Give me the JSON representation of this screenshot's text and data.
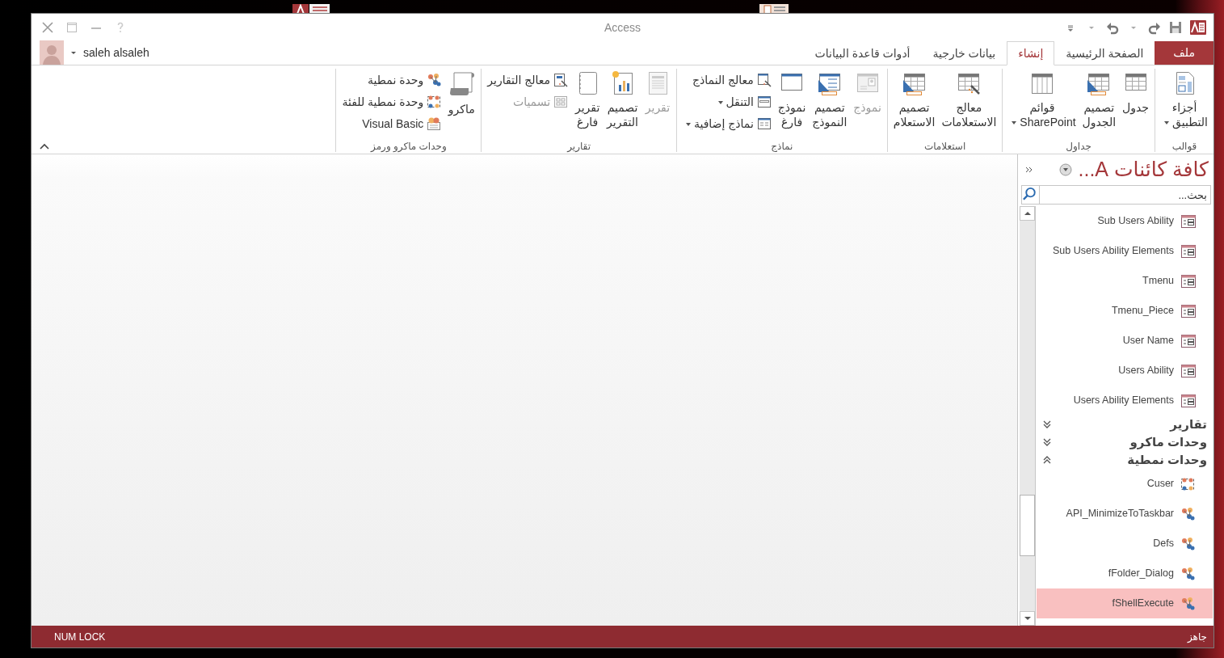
{
  "window": {
    "title": "Access"
  },
  "account": {
    "name": "saleh alsaleh"
  },
  "tabs": [
    {
      "label": "ملف",
      "kind": "file",
      "selected": false
    },
    {
      "label": "الصفحة الرئيسية",
      "kind": "tab",
      "selected": false
    },
    {
      "label": "إنشاء",
      "kind": "tab",
      "selected": true
    },
    {
      "label": "بيانات خارجية",
      "kind": "tab",
      "selected": false
    },
    {
      "label": "أدوات قاعدة البيانات",
      "kind": "tab",
      "selected": false
    }
  ],
  "ribbon_groups": [
    {
      "label": "قوالب",
      "buttons": [
        {
          "label": "أجزاء\nالتطبيق",
          "kind": "parts",
          "dropdown": true,
          "disabled": false
        }
      ]
    },
    {
      "label": "جداول",
      "buttons": [
        {
          "label": "جدول",
          "kind": "table",
          "dropdown": false,
          "disabled": false
        },
        {
          "label": "تصميم\nالجدول",
          "kind": "tabledesign",
          "dropdown": false,
          "disabled": false
        },
        {
          "label": "قوائم\nSharePoint",
          "kind": "sharepoint",
          "dropdown": true,
          "disabled": false
        }
      ]
    },
    {
      "label": "استعلامات",
      "buttons": [
        {
          "label": "معالج\nالاستعلامات",
          "kind": "querywizard",
          "dropdown": false,
          "disabled": false
        },
        {
          "label": "تصميم\nالاستعلام",
          "kind": "querydesign",
          "dropdown": false,
          "disabled": false
        }
      ]
    },
    {
      "label": "نماذج",
      "buttons": [
        {
          "label": "نموذج",
          "kind": "form",
          "dropdown": false,
          "disabled": true
        },
        {
          "label": "تصميم\nالنموذج",
          "kind": "formdesign",
          "dropdown": false,
          "disabled": false
        },
        {
          "label": "نموذج\nفارغ",
          "kind": "blankform",
          "dropdown": false,
          "disabled": false
        },
        {
          "label": "معالج النماذج",
          "kind": "formwizard",
          "dropdown": false,
          "disabled": false
        },
        {
          "label": "التنقل",
          "kind": "navigation",
          "dropdown": true,
          "disabled": false
        },
        {
          "label": "نماذج إضافية",
          "kind": "moreforms",
          "dropdown": true,
          "disabled": false
        }
      ]
    },
    {
      "label": "تقارير",
      "buttons": [
        {
          "label": "تقرير",
          "kind": "report",
          "dropdown": false,
          "disabled": true
        },
        {
          "label": "تصميم\nالتقرير",
          "kind": "reportdesign",
          "dropdown": false,
          "disabled": false
        },
        {
          "label": "تقرير\nفارغ",
          "kind": "blankreport",
          "dropdown": false,
          "disabled": false
        },
        {
          "label": "معالج التقارير",
          "kind": "reportwizard",
          "dropdown": false,
          "disabled": false
        },
        {
          "label": "تسميات",
          "kind": "labels",
          "dropdown": false,
          "disabled": true
        }
      ]
    },
    {
      "label": "وحدات ماكرو ورمز",
      "buttons": [
        {
          "label": "ماكرو",
          "kind": "macro",
          "dropdown": false,
          "disabled": false
        },
        {
          "label": "وحدة نمطية",
          "kind": "module",
          "dropdown": false,
          "disabled": false
        },
        {
          "label": "وحدة نمطية للفئة",
          "kind": "classmodule",
          "dropdown": false,
          "disabled": false
        },
        {
          "label": "Visual Basic",
          "kind": "vba",
          "dropdown": false,
          "disabled": false
        }
      ]
    }
  ],
  "nav_pane": {
    "title": "كافة كائنات A...",
    "search": {
      "placeholder": "بحث..."
    },
    "entries": [
      {
        "kind": "table",
        "label": "Sub Users Ability",
        "selected": false
      },
      {
        "kind": "table",
        "label": "Sub Users Ability Elements",
        "selected": false
      },
      {
        "kind": "table",
        "label": "Tmenu",
        "selected": false
      },
      {
        "kind": "table",
        "label": "Tmenu_Piece",
        "selected": false
      },
      {
        "kind": "table",
        "label": "User Name",
        "selected": false
      },
      {
        "kind": "table",
        "label": "Users Ability",
        "selected": false
      },
      {
        "kind": "table",
        "label": "Users Ability Elements",
        "selected": false
      },
      {
        "kind": "group",
        "label": "تقارير",
        "expanded": false
      },
      {
        "kind": "group",
        "label": "وحدات ماكرو",
        "expanded": false
      },
      {
        "kind": "group",
        "label": "وحدات نمطية",
        "expanded": true
      },
      {
        "kind": "class-module",
        "label": "Cuser",
        "selected": false
      },
      {
        "kind": "module",
        "label": "API_MinimizeToTaskbar",
        "selected": false
      },
      {
        "kind": "module",
        "label": "Defs",
        "selected": false
      },
      {
        "kind": "module",
        "label": "fFolder_Dialog",
        "selected": false
      },
      {
        "kind": "module",
        "label": "fShellExecute",
        "selected": true
      }
    ]
  },
  "status_bar": {
    "message": "جاهز",
    "indicator": "NUM LOCK"
  }
}
